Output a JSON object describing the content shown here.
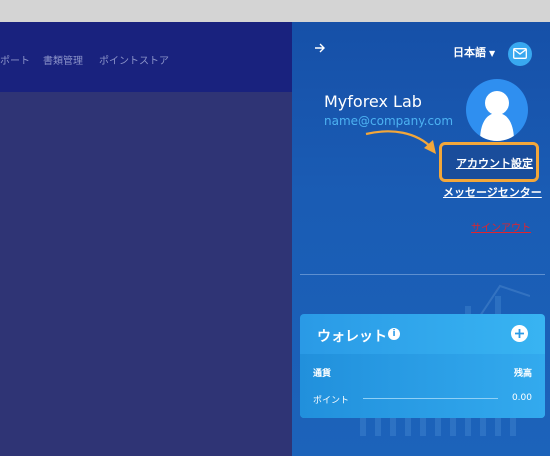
{
  "topnav": {
    "items": [
      "ポート",
      "書類管理",
      "ポイントストア"
    ]
  },
  "panel": {
    "collapse_icon": "arrow-right-icon",
    "language": "日本語",
    "mail_icon": "mail-icon",
    "user": {
      "name": "Myforex Lab",
      "email": "name@company.com",
      "avatar_icon": "user-silhouette-icon"
    },
    "links": {
      "account_settings": "アカウント設定",
      "message_center": "メッセージセンター",
      "logout": "サインアウト"
    },
    "wallet": {
      "title": "ウォレット",
      "columns": {
        "currency": "通貨",
        "balance": "残高"
      },
      "rows": [
        {
          "label": "ポイント",
          "value": "0.00"
        }
      ]
    }
  },
  "colors": {
    "panel_bg": "#1a5cb4",
    "highlight": "#f3a73a",
    "logout": "#e0242e",
    "email": "#4cb2f2",
    "wallet": "#2a9ae6"
  }
}
